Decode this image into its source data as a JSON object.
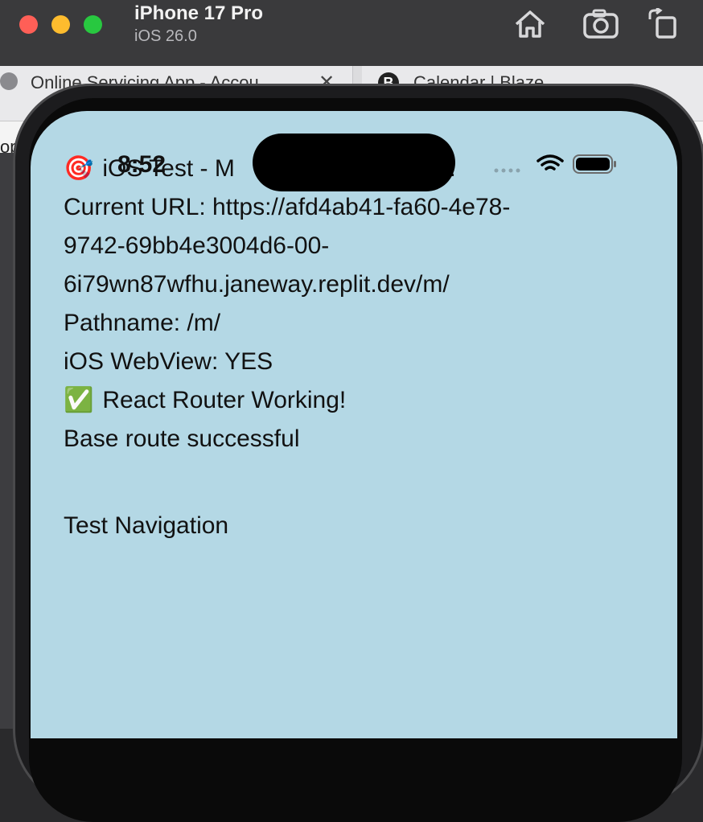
{
  "simulator": {
    "device_name": "iPhone 17 Pro",
    "os_version": "iOS 26.0"
  },
  "host_window": {
    "tabs": [
      {
        "label": "Online Servicing App - Accou"
      },
      {
        "label": "Calendar | Blaze"
      }
    ],
    "left_fragment": "op"
  },
  "status_bar": {
    "time": "8:52"
  },
  "page": {
    "title_emoji": "🎯",
    "title_text_left": "iOS Test - M",
    "title_text_right": "g!",
    "current_url_label": "Current URL: https://afd4ab41-fa60-4e78-",
    "current_url_line2": "9742-69bb4e3004d6-00-",
    "current_url_line3": "6i79wn87wfhu.janeway.replit.dev/m/",
    "pathname": "Pathname: /m/",
    "webview": "iOS WebView: YES",
    "router_check_emoji": "✅",
    "router_status": "React Router Working!",
    "base_route": "Base route successful",
    "nav_heading": "Test Navigation"
  },
  "colors": {
    "screen_bg": "#b4d8e5",
    "traffic_red": "#ff5f57",
    "traffic_yellow": "#febc2e",
    "traffic_green": "#28c840"
  }
}
